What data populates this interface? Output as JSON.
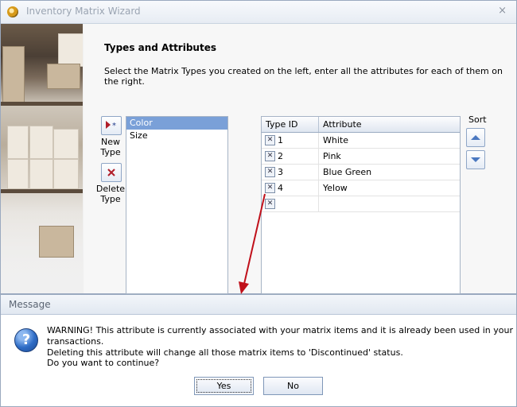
{
  "window": {
    "title": "Inventory Matrix Wizard",
    "close_glyph": "×"
  },
  "section": {
    "title": "Types and Attributes",
    "description": "Select the Matrix Types you created on the left, enter all the attributes for each of them on the right."
  },
  "toolbar": {
    "new_type_label_1": "New",
    "new_type_label_2": "Type",
    "delete_type_label_1": "Delete",
    "delete_type_label_2": "Type"
  },
  "types": {
    "items": [
      "Color",
      "Size"
    ],
    "selected": "Color"
  },
  "grid": {
    "columns": [
      "Type ID",
      "Attribute"
    ],
    "rows": [
      {
        "type_id": "1",
        "attribute": "White"
      },
      {
        "type_id": "2",
        "attribute": "Pink"
      },
      {
        "type_id": "3",
        "attribute": "Blue Green"
      },
      {
        "type_id": "4",
        "attribute": "Yelow"
      }
    ]
  },
  "sort": {
    "label": "Sort"
  },
  "message": {
    "title": "Message",
    "line1": "WARNING! This attribute is currently associated with your matrix items and it is already been used in your transactions.",
    "line2": "Deleting this attribute will change all those matrix items to 'Discontinued' status.",
    "question": "Do you want to continue?",
    "yes": "Yes",
    "no": "No"
  },
  "colors": {
    "accent": "#7aa0d8",
    "annotation_arrow": "#c0101a"
  },
  "icons": {
    "app": "app-icon",
    "new_type": "new-type-icon",
    "delete_type": "delete-type-icon",
    "sort_up": "sort-up-icon",
    "sort_down": "sort-down-icon",
    "question": "question-icon"
  }
}
